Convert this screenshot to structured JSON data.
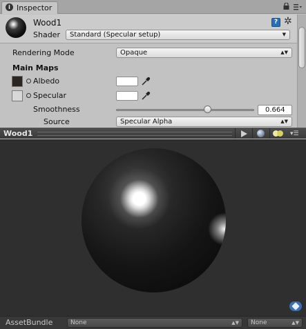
{
  "tab": {
    "label": "Inspector"
  },
  "material": {
    "name": "Wood1",
    "shader_label": "Shader",
    "shader_value": "Standard (Specular setup)"
  },
  "properties": {
    "rendering_mode_label": "Rendering Mode",
    "rendering_mode_value": "Opaque",
    "main_maps_label": "Main Maps",
    "albedo_label": "Albedo",
    "albedo_color": "#ffffff",
    "albedo_texture_color": "#2b2622",
    "specular_label": "Specular",
    "specular_color": "#ffffff",
    "smoothness_label": "Smoothness",
    "smoothness_value": "0.664",
    "smoothness_fraction": 0.664,
    "source_label": "Source",
    "source_value": "Specular Alpha"
  },
  "preview": {
    "title": "Wood1"
  },
  "asset_bundle": {
    "label": "AssetBundle",
    "name_value": "None",
    "variant_value": "None"
  },
  "icons": [
    "info-icon",
    "lock-icon",
    "tab-menu-icon",
    "material-sphere-icon",
    "help-book-icon",
    "gear-icon",
    "eyedropper-icon",
    "play-icon",
    "preview-mesh-icon",
    "preview-light-icon",
    "preview-menu-icon",
    "asset-label-icon"
  ],
  "colors": {
    "accent": "#3b6fb5",
    "preview_background": "#2f2f2f",
    "panel": "#c2c2c2"
  }
}
